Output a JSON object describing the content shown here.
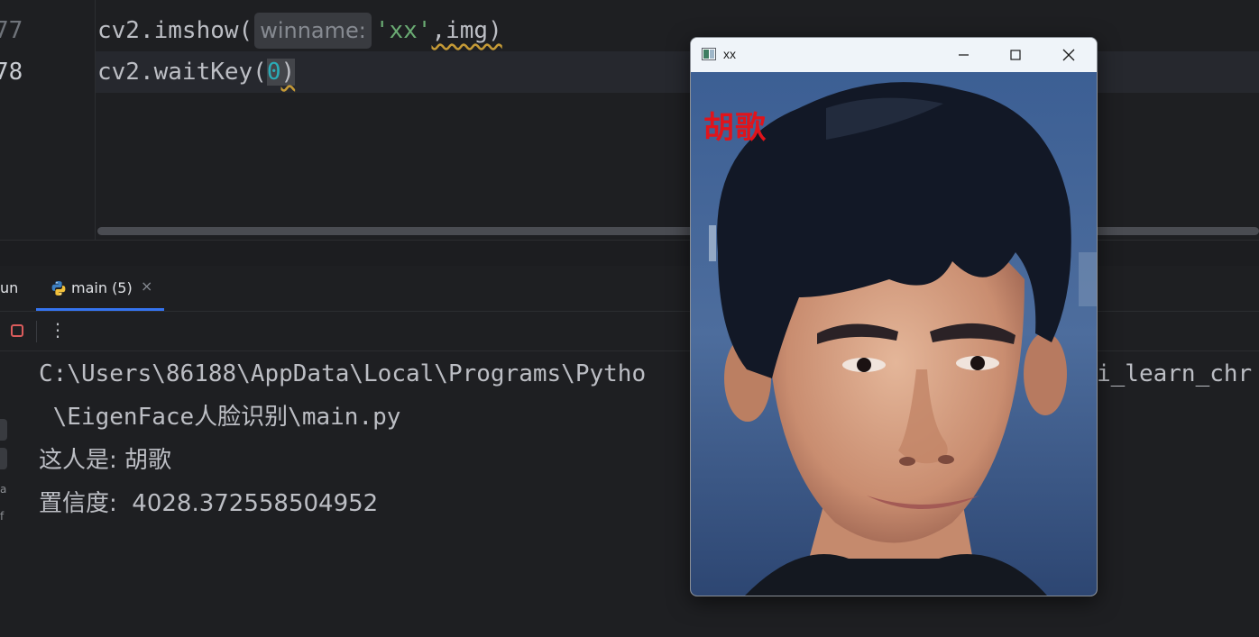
{
  "editor": {
    "lines": [
      {
        "number": "77",
        "func": "cv2.imshow(",
        "hint": "winname:",
        "arg_str": "'xx'",
        "rest": ",img)"
      },
      {
        "number": "78",
        "func": "cv2.waitKey(",
        "arg_num": "0",
        "close": ")"
      }
    ]
  },
  "run_panel": {
    "title": "un",
    "tab_label": "main (5)",
    "tab_close": "×",
    "toolbar": {
      "more": "⋮"
    }
  },
  "console": {
    "lines": [
      "C:\\Users\\86188\\AppData\\Local\\Programs\\Pytho",
      "i_learn_chr",
      " \\EigenFace人脸识别\\main.py",
      "这人是: 胡歌",
      "置信度:  4028.372558504952"
    ]
  },
  "cv_window": {
    "title": "xx",
    "overlay_text": "胡歌"
  },
  "colors": {
    "accent": "#3574f0",
    "stop": "#db5c5c",
    "overlay_text": "#e0141b"
  }
}
